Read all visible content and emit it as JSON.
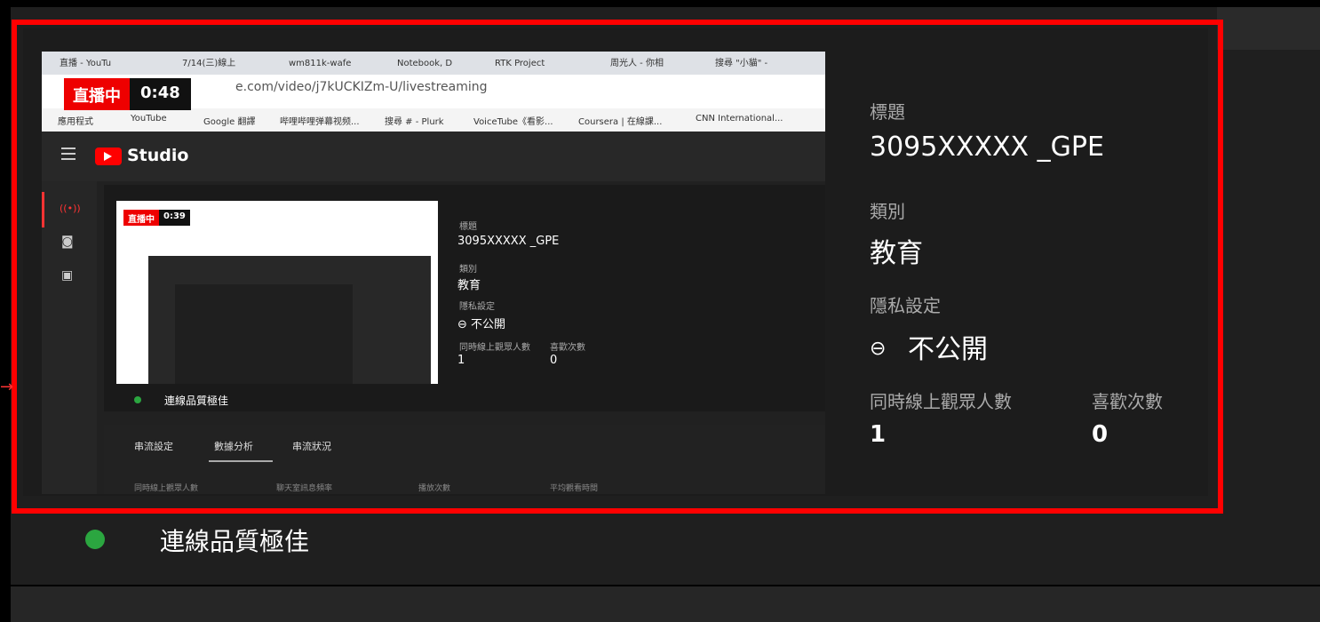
{
  "thumbnail": {
    "live_label": "直播中",
    "live_time": "0:48",
    "browser_tabs": [
      "直播 - YouTu",
      "7/14(三)線上",
      "wm811k-wafe",
      "Notebook, D",
      "RTK Project",
      "周光人 - 你相",
      "搜尋 \"小貓\" -"
    ],
    "url": "e.com/video/j7kUCKIZm-U/livestreaming",
    "bookmarks": [
      "應用程式",
      "YouTube",
      "Google 翻譯",
      "哔哩哔哩弹幕视频...",
      "搜尋 # - Plurk",
      "VoiceTube《看影...",
      "Coursera | 在線課...",
      "CNN International..."
    ],
    "studio_label": "Studio",
    "inner": {
      "live_label": "直播中",
      "live_time": "0:39",
      "title_label": "標題",
      "title": "3095XXXXX _GPE",
      "category_label": "類別",
      "category": "教育",
      "privacy_label": "隱私設定",
      "privacy": "不公開",
      "viewers_label": "同時線上觀眾人數",
      "viewers": "1",
      "likes_label": "喜歡次數",
      "likes": "0",
      "quality": "連線品質極佳",
      "tabs": [
        "串流設定",
        "數據分析",
        "串流狀況"
      ],
      "metrics": [
        "同時線上觀眾人數",
        "聊天室訊息頻率",
        "播放次數",
        "平均觀看時間"
      ]
    }
  },
  "info": {
    "title_label": "標題",
    "title": "3095XXXXX _GPE",
    "category_label": "類別",
    "category": "教育",
    "privacy_label": "隱私設定",
    "privacy": "不公開",
    "viewers_label": "同時線上觀眾人數",
    "viewers": "1",
    "likes_label": "喜歡次數",
    "likes": "0"
  },
  "status": {
    "quality": "連線品質極佳",
    "dot_color": "#2ba640"
  },
  "colors": {
    "highlight": "#ff0000",
    "live": "#ee0000"
  }
}
